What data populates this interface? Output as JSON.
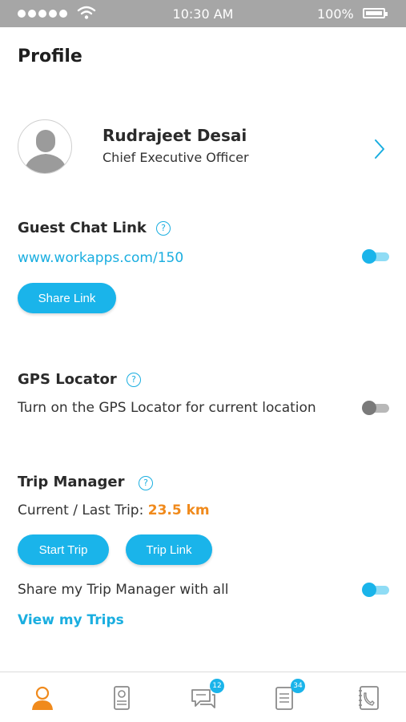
{
  "status_bar": {
    "time": "10:30 AM",
    "battery": "100%"
  },
  "page": {
    "title": "Profile"
  },
  "profile": {
    "name": "Rudrajeet Desai",
    "role": "Chief Executive Officer"
  },
  "guest_chat": {
    "title": "Guest Chat Link",
    "url": "www.workapps.com/150",
    "enabled": true,
    "share_button": "Share Link"
  },
  "gps": {
    "title": "GPS Locator",
    "description": "Turn on the GPS Locator for current location",
    "enabled": false
  },
  "trip": {
    "title": "Trip Manager",
    "current_label": "Current / Last Trip:",
    "current_value": "23.5 km",
    "start_button": "Start Trip",
    "link_button": "Trip Link",
    "share_label": "Share my Trip Manager with all",
    "share_enabled": true,
    "view_link": "View my Trips"
  },
  "colors": {
    "accent": "#1ab4ea",
    "highlight": "#f08a1c",
    "status_bar": "#a6a6a6"
  },
  "tab_bar": {
    "items": [
      {
        "icon": "profile-icon",
        "active": true
      },
      {
        "icon": "contact-card-icon",
        "active": false
      },
      {
        "icon": "chat-icon",
        "badge": "12",
        "active": false
      },
      {
        "icon": "notes-icon",
        "badge": "34",
        "active": false
      },
      {
        "icon": "phonebook-icon",
        "active": false
      }
    ]
  }
}
